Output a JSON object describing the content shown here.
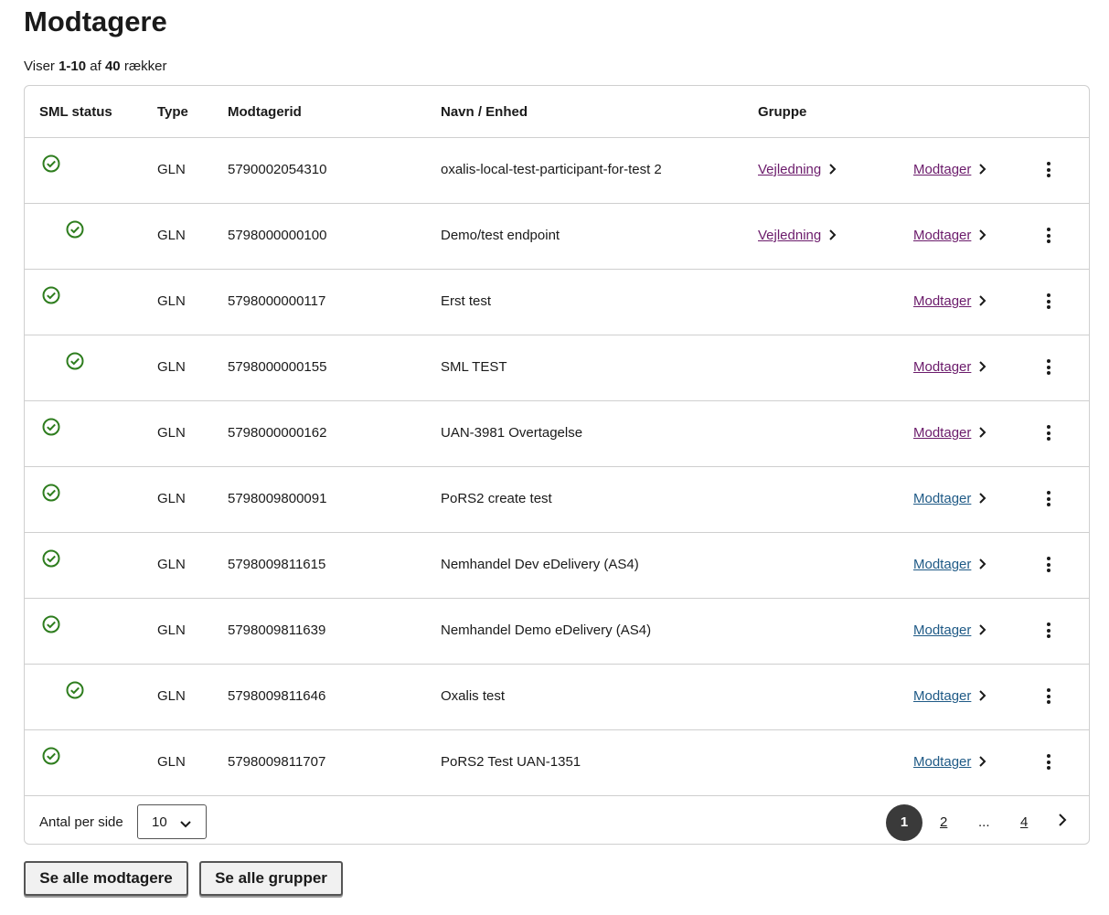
{
  "page": {
    "title": "Modtagere"
  },
  "summary": {
    "prefix": "Viser",
    "range": "1-10",
    "of": "af",
    "total": "40",
    "suffix": "rækker"
  },
  "table": {
    "headers": {
      "status": "SML status",
      "type": "Type",
      "id": "Modtagerid",
      "name": "Navn / Enhed",
      "group": "Gruppe"
    },
    "rows": [
      {
        "status": "ok",
        "type": "GLN",
        "id": "5790002054310",
        "name": "oxalis-local-test-participant-for-test 2",
        "group_link": "Vejledning",
        "receiver_link": "Modtager"
      },
      {
        "status": "ok",
        "type": "GLN",
        "id": "5798000000100",
        "name": "Demo/test endpoint",
        "group_link": "Vejledning",
        "receiver_link": "Modtager"
      },
      {
        "status": "ok",
        "type": "GLN",
        "id": "5798000000117",
        "name": "Erst test",
        "group_link": "",
        "receiver_link": "Modtager"
      },
      {
        "status": "ok",
        "type": "GLN",
        "id": "5798000000155",
        "name": "SML TEST",
        "group_link": "",
        "receiver_link": "Modtager"
      },
      {
        "status": "ok",
        "type": "GLN",
        "id": "5798000000162",
        "name": "UAN-3981 Overtagelse",
        "group_link": "",
        "receiver_link": "Modtager"
      },
      {
        "status": "ok",
        "type": "GLN",
        "id": "5798009800091",
        "name": "PoRS2 create test",
        "group_link": "",
        "receiver_link": "Modtager"
      },
      {
        "status": "ok",
        "type": "GLN",
        "id": "5798009811615",
        "name": "Nemhandel Dev eDelivery (AS4)",
        "group_link": "",
        "receiver_link": "Modtager"
      },
      {
        "status": "ok",
        "type": "GLN",
        "id": "5798009811639",
        "name": "Nemhandel Demo eDelivery (AS4)",
        "group_link": "",
        "receiver_link": "Modtager"
      },
      {
        "status": "ok",
        "type": "GLN",
        "id": "5798009811646",
        "name": "Oxalis test",
        "group_link": "",
        "receiver_link": "Modtager"
      },
      {
        "status": "ok",
        "type": "GLN",
        "id": "5798009811707",
        "name": "PoRS2 Test UAN-1351",
        "group_link": "",
        "receiver_link": "Modtager"
      }
    ]
  },
  "footer": {
    "per_page_label": "Antal per side",
    "per_page_value": "10",
    "pages": {
      "current": "1",
      "second": "2",
      "ellipsis": "...",
      "last": "4"
    }
  },
  "buttons": {
    "all_receivers": "Se alle modtagere",
    "all_groups": "Se alle grupper"
  },
  "colors": {
    "status_ok": "#2e7d1e",
    "link_visited": "#6b1b6b",
    "link": "#1f5a86",
    "pager_active": "#3a3a3a"
  }
}
